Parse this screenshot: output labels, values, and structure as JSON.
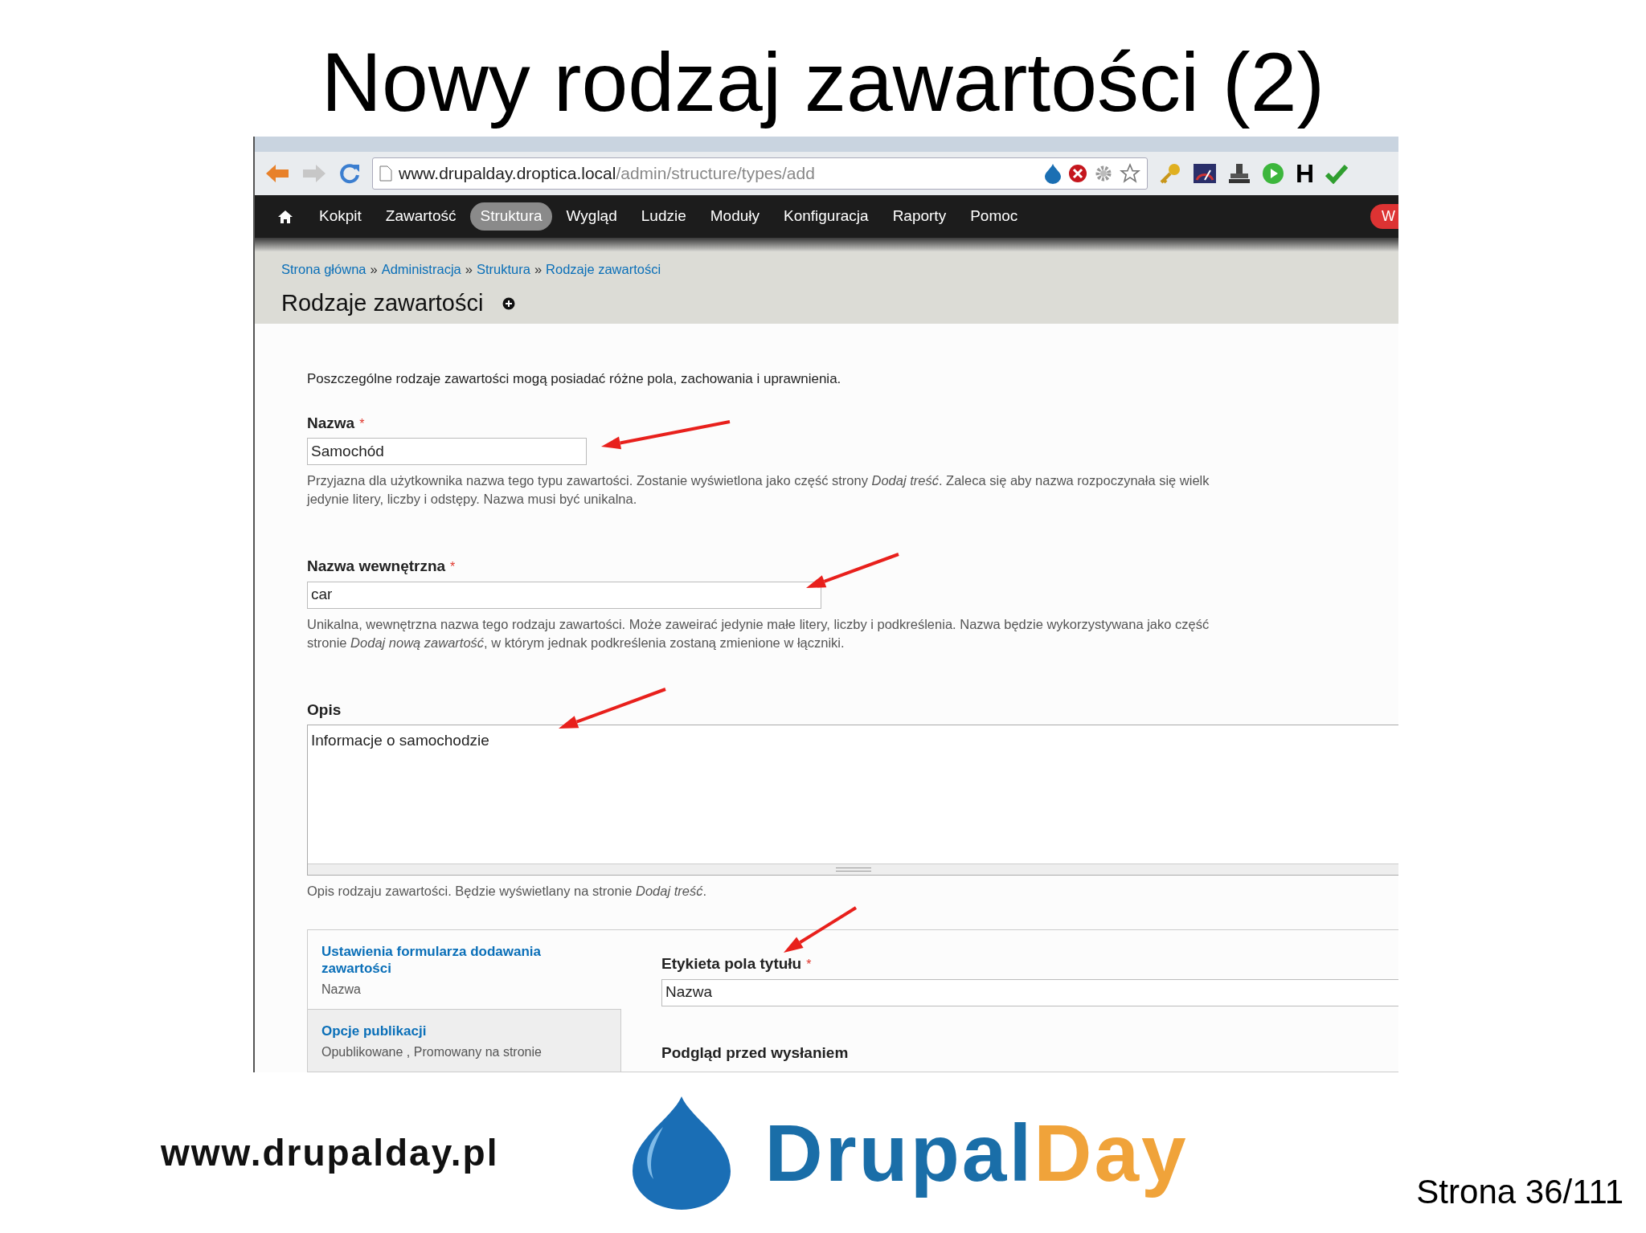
{
  "slide": {
    "title": "Nowy rodzaj zawartości (2)",
    "footer_url": "www.drupalday.pl",
    "logo_parts": [
      "Drupal",
      "Day"
    ],
    "page_number": "Strona 36/111"
  },
  "browser": {
    "url_host": "www.drupalday.droptica.local",
    "url_path": "/admin/structure/types/add",
    "toolbar_letter": "H"
  },
  "nav": [
    {
      "label": "Kokpit",
      "selected": false
    },
    {
      "label": "Zawartość",
      "selected": false
    },
    {
      "label": "Struktura",
      "selected": true
    },
    {
      "label": "Wygląd",
      "selected": false
    },
    {
      "label": "Ludzie",
      "selected": false
    },
    {
      "label": "Moduły",
      "selected": false
    },
    {
      "label": "Konfiguracja",
      "selected": false
    },
    {
      "label": "Raporty",
      "selected": false
    },
    {
      "label": "Pomoc",
      "selected": false
    }
  ],
  "nav_badge": "W",
  "required_mark": "*",
  "breadcrumb_separator": "»",
  "breadcrumb": [
    "Strona główna",
    "Administracja",
    "Struktura",
    "Rodzaje zawartości"
  ],
  "page_title": "Rodzaje zawartości",
  "intro": "Poszczególne rodzaje zawartości mogą posiadać różne pola, zachowania i uprawnienia.",
  "fields": [
    {
      "kind": "text",
      "label": "Nazwa",
      "required": true,
      "value": "Samochód",
      "help": [
        "Przyjazna dla użytkownika nazwa tego typu zawartości. Zostanie wyświetlona jako część strony *Dodaj treść*. Zaleca się aby nazwa rozpoczynała się wielk",
        "jedynie litery, liczby i odstępy. Nazwa musi być unikalna."
      ]
    },
    {
      "kind": "text",
      "label": "Nazwa wewnętrzna",
      "required": true,
      "value": "car",
      "help": [
        "Unikalna, wewnętrzna nazwa tego rodzaju zawartości. Może zaweirać jedynie małe litery, liczby i podkreślenia. Nazwa będzie wykorzystywana jako część",
        "stronie *Dodaj nową zawartość*, w którym jednak podkreślenia zostaną zmienione w łączniki."
      ]
    },
    {
      "kind": "textarea",
      "label": "Opis",
      "required": false,
      "value": "Informacje o samochodzie",
      "help": [
        "Opis rodzaju zawartości. Będzie wyświetlany na stronie *Dodaj treść*."
      ]
    }
  ],
  "vertical_tabs": [
    {
      "title": "Ustawienia formularza dodawania zawartości",
      "summary": "Nazwa",
      "selected": true
    },
    {
      "title": "Opcje publikacji",
      "summary": "Opublikowane , Promowany na stronie",
      "selected": false
    }
  ],
  "tab_panel": {
    "label": "Etykieta pola tytułu",
    "required": true,
    "value": "Nazwa",
    "next_label": "Podgląd przed wysłaniem"
  }
}
